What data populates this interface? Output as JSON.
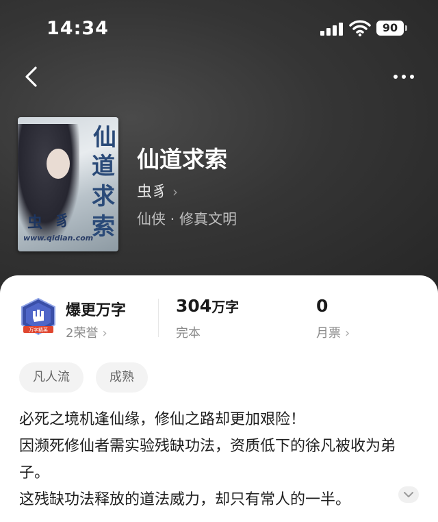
{
  "status_bar": {
    "time": "14:34",
    "battery": "90"
  },
  "book": {
    "title": "仙道求索",
    "author": "虫豸",
    "genre": "仙侠 · 修真文明",
    "cover_title": [
      "仙",
      "道",
      "求",
      "索"
    ],
    "cover_author": [
      "虫",
      "豸"
    ],
    "cover_url": "www.qidian.com"
  },
  "stats": {
    "honor_title": "爆更万字",
    "honor_sub": "2荣誉",
    "badge_ribbon": "万字精英",
    "words_number": "304",
    "words_unit": "万字",
    "words_sub": "完本",
    "tickets": "0",
    "tickets_sub": "月票"
  },
  "tags": [
    "凡人流",
    "成熟"
  ],
  "description": [
    "必死之境机逢仙缘，修仙之路却更加艰险！",
    "因濒死修仙者需实验残缺功法，资质低下的徐凡被收为弟子。",
    "这残缺功法释放的道法威力，却只有常人的一半。"
  ],
  "icons": {
    "back": "chevron-left-icon",
    "more": "more-horizontal-icon",
    "chevron": "chevron-right-icon",
    "expand": "chevron-down-icon"
  }
}
